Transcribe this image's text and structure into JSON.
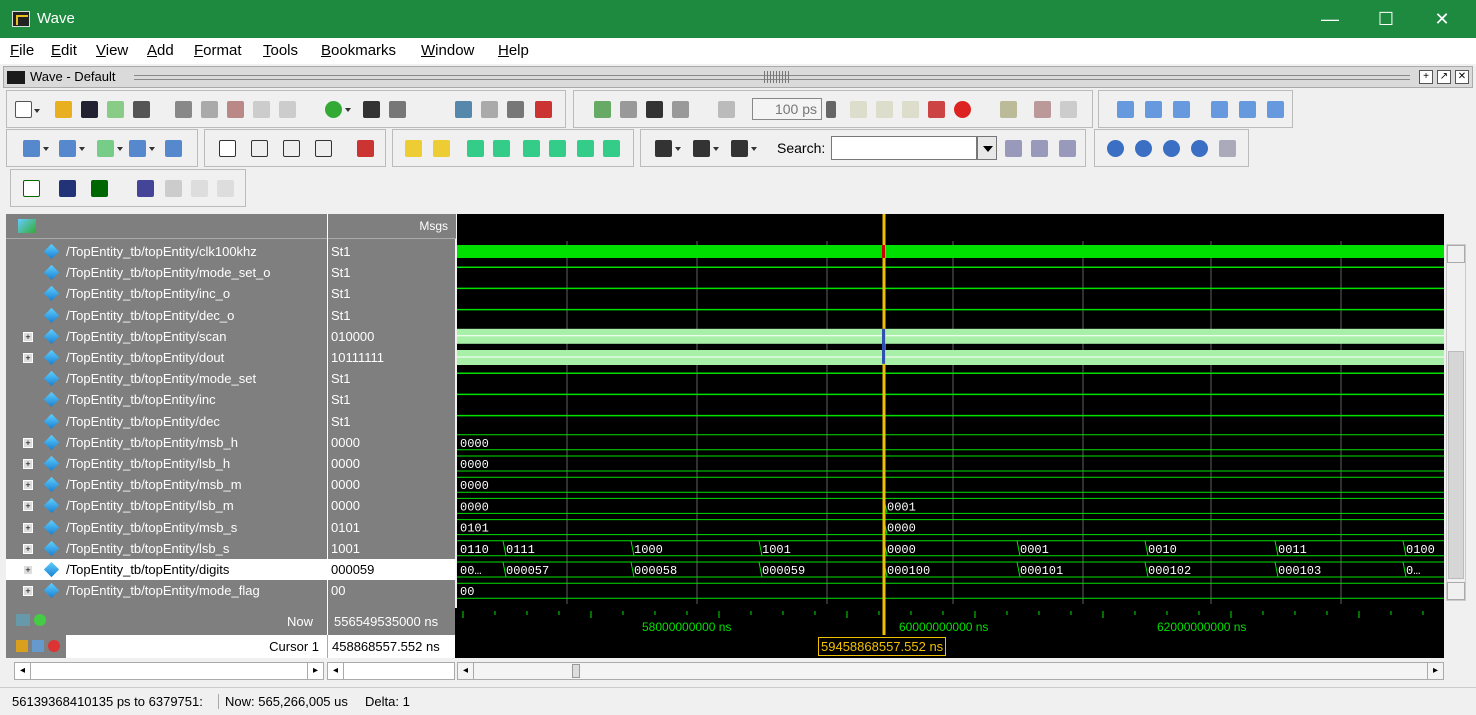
{
  "window": {
    "title": "Wave",
    "minimize": "—",
    "maximize": "☐",
    "close": "✕",
    "icon": "modelsim-app-icon"
  },
  "menu": [
    "File",
    "Edit",
    "View",
    "Add",
    "Format",
    "Tools",
    "Bookmarks",
    "Window",
    "Help"
  ],
  "subwindow": {
    "title": "Wave - Default"
  },
  "toolbar": {
    "zoom_value": "100 ps",
    "search_label": "Search:",
    "search_value": ""
  },
  "panes": {
    "msgs_header": "Msgs"
  },
  "signals": [
    {
      "name": "/TopEntity_tb/topEntity/clk100khz",
      "value": "St1",
      "expandable": false
    },
    {
      "name": "/TopEntity_tb/topEntity/mode_set_o",
      "value": "St1",
      "expandable": false
    },
    {
      "name": "/TopEntity_tb/topEntity/inc_o",
      "value": "St1",
      "expandable": false
    },
    {
      "name": "/TopEntity_tb/topEntity/dec_o",
      "value": "St1",
      "expandable": false
    },
    {
      "name": "/TopEntity_tb/topEntity/scan",
      "value": "010000",
      "expandable": true
    },
    {
      "name": "/TopEntity_tb/topEntity/dout",
      "value": "10111111",
      "expandable": true
    },
    {
      "name": "/TopEntity_tb/topEntity/mode_set",
      "value": "St1",
      "expandable": false
    },
    {
      "name": "/TopEntity_tb/topEntity/inc",
      "value": "St1",
      "expandable": false
    },
    {
      "name": "/TopEntity_tb/topEntity/dec",
      "value": "St1",
      "expandable": false
    },
    {
      "name": "/TopEntity_tb/topEntity/msb_h",
      "value": "0000",
      "expandable": true
    },
    {
      "name": "/TopEntity_tb/topEntity/lsb_h",
      "value": "0000",
      "expandable": true
    },
    {
      "name": "/TopEntity_tb/topEntity/msb_m",
      "value": "0000",
      "expandable": true
    },
    {
      "name": "/TopEntity_tb/topEntity/lsb_m",
      "value": "0000",
      "expandable": true
    },
    {
      "name": "/TopEntity_tb/topEntity/msb_s",
      "value": "0101",
      "expandable": true
    },
    {
      "name": "/TopEntity_tb/topEntity/lsb_s",
      "value": "1001",
      "expandable": true
    },
    {
      "name": "/TopEntity_tb/topEntity/digits",
      "value": "000059",
      "expandable": true,
      "selected": true
    },
    {
      "name": "/TopEntity_tb/topEntity/mode_flag",
      "value": "00",
      "expandable": true
    }
  ],
  "bus_segments": {
    "msb_h": [
      "0000"
    ],
    "lsb_h": [
      "0000"
    ],
    "msb_m": [
      "0000"
    ],
    "lsb_m": [
      "0000",
      "0001"
    ],
    "msb_s": [
      "0101",
      "0000"
    ],
    "lsb_s": [
      "0110",
      "0111",
      "1000",
      "1001",
      "0000",
      "0001",
      "0010",
      "0011",
      "0100"
    ],
    "digits": [
      "00…",
      "000057",
      "000058",
      "000059",
      "000100",
      "000101",
      "000102",
      "000103",
      "0…"
    ],
    "mode_flag": [
      "00"
    ]
  },
  "time": {
    "now_label": "Now",
    "now_value": "556549535000 ns",
    "cursor_label": "Cursor 1",
    "cursor_value": "458868557.552 ns",
    "cursor_marker": "59458868557.552 ns",
    "tick_labels": [
      "58000000000 ns",
      "60000000000 ns",
      "62000000000 ns"
    ]
  },
  "status": {
    "range": "56139368410135 ps to 6379751:",
    "now": "Now: 565,266,005 us",
    "delta": "Delta: 1"
  },
  "colors": {
    "titlebar": "#1d8a3f",
    "wave_green": "#00e000",
    "bus_green": "#a8f0a8",
    "cursor": "#f0c000",
    "timeline_text": "#00e000"
  }
}
